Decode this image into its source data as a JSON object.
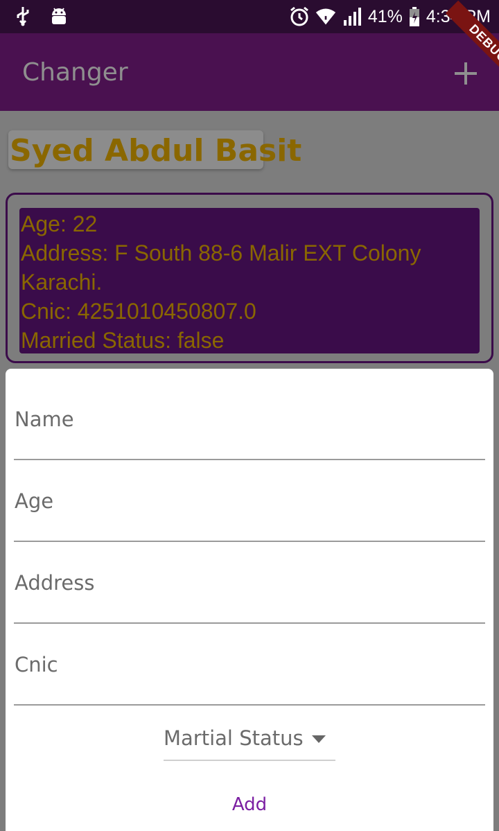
{
  "status_bar": {
    "left_icons": [
      "usb-icon",
      "android-debug-icon"
    ],
    "right_icons": [
      "alarm-icon",
      "wifi-icon",
      "signal-icon",
      "battery-icon"
    ],
    "battery_percent": "41%",
    "time": "4:34 PM"
  },
  "app_bar": {
    "title": "Changer",
    "action_icon": "add-icon"
  },
  "debug_banner": "DEBUG",
  "person": {
    "name": "Syed Abdul Basit",
    "age_line": "Age: 22",
    "address_line1": "Address: F South 88-6 Malir EXT Colony",
    "address_line2": "Karachi.",
    "cnic_line": "Cnic: 4251010450807.0",
    "married_line": "Married Status: false"
  },
  "form": {
    "name_label": "Name",
    "age_label": "Age",
    "address_label": "Address",
    "cnic_label": "Cnic",
    "status_dropdown": "Martial Status",
    "submit_label": "Add"
  },
  "colors": {
    "app_bar": "#4a1150",
    "accent": "#7b1fa2",
    "gold_text": "#8a6700"
  }
}
